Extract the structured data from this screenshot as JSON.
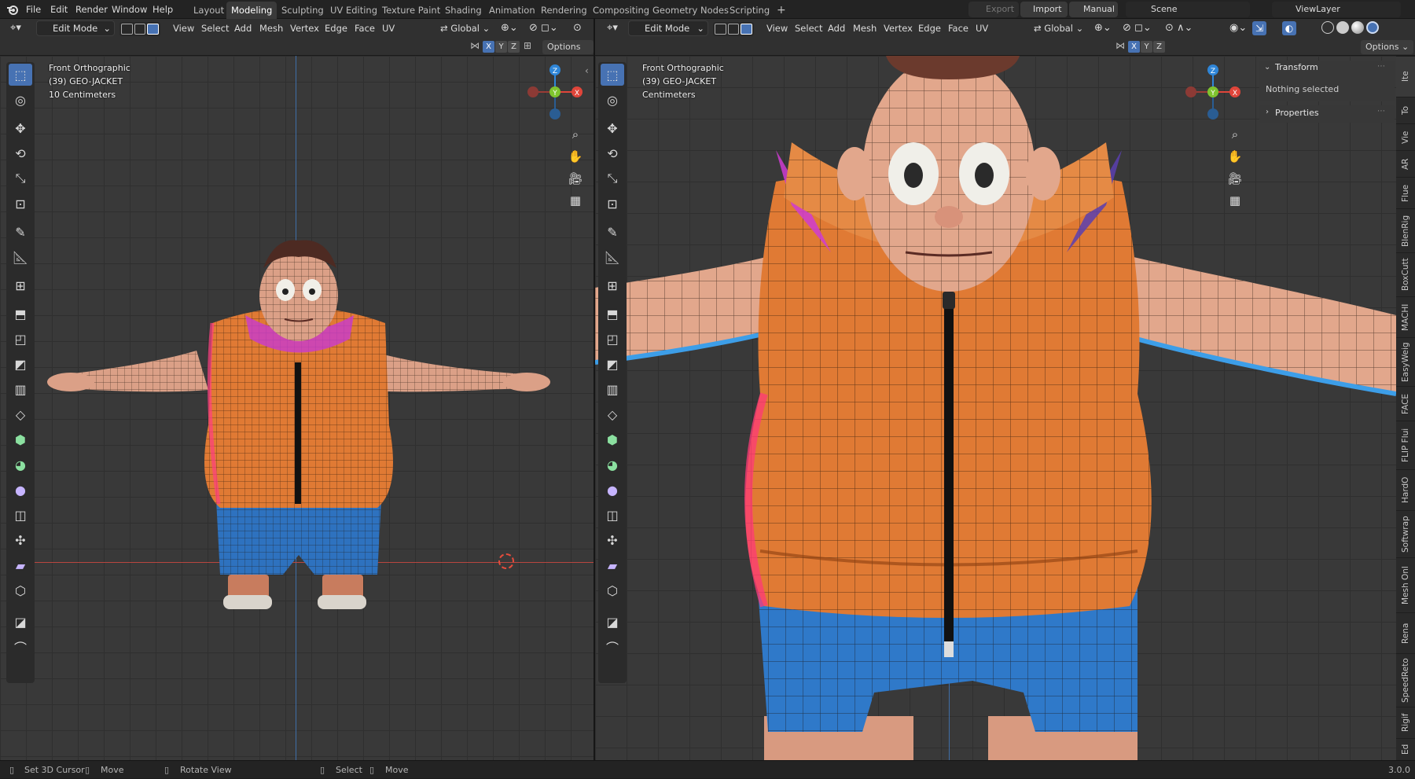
{
  "app": {
    "version": "3.0.0"
  },
  "menu": [
    "File",
    "Edit",
    "Render",
    "Window",
    "Help"
  ],
  "workspaces": [
    "Layout",
    "Modeling",
    "Sculpting",
    "UV Editing",
    "Texture Paint",
    "Shading",
    "Animation",
    "Rendering",
    "Compositing",
    "Geometry Nodes",
    "Scripting"
  ],
  "active_workspace": "Modeling",
  "top_right": {
    "export_label": "Export",
    "import_label": "Import",
    "manual_label": "Manual",
    "scene_label": "Scene",
    "viewlayer_label": "ViewLayer"
  },
  "left_view": {
    "mode": "Edit Mode",
    "menus": [
      "View",
      "Select",
      "Add",
      "Mesh",
      "Vertex",
      "Edge",
      "Face",
      "UV"
    ],
    "orientation": "Global",
    "axes": [
      "X",
      "Y",
      "Z"
    ],
    "options_label": "Options",
    "overlay": {
      "view_name": "Front Orthographic",
      "object": "(39) GEO-JACKET",
      "scale": "10 Centimeters"
    }
  },
  "right_view": {
    "mode": "Edit Mode",
    "menus": [
      "View",
      "Select",
      "Add",
      "Mesh",
      "Vertex",
      "Edge",
      "Face",
      "UV"
    ],
    "orientation": "Global",
    "axes": [
      "X",
      "Y",
      "Z"
    ],
    "options_label": "Options",
    "overlay": {
      "view_name": "Front Orthographic",
      "object": "(39) GEO-JACKET",
      "scale": "Centimeters"
    }
  },
  "gizmo": {
    "z": "Z",
    "y": "Y",
    "x": "X"
  },
  "sidebar_panel": {
    "transform_title": "Transform",
    "nothing_selected": "Nothing selected",
    "properties_title": "Properties"
  },
  "side_tabs": [
    "Ite",
    "To",
    "Vie",
    "AR",
    "Flue",
    "BlenRig",
    "BoxCutt",
    "MACHI",
    "EasyWeig",
    "FACE",
    "FLIP Flui",
    "HardO",
    "Softwrap",
    "Mesh Onl",
    "Rena",
    "SpeedReto",
    "Rigif",
    "Ed"
  ],
  "status": [
    {
      "icon": "mouse-left-icon",
      "label": "Set 3D Cursor"
    },
    {
      "icon": "mouse-middle-icon",
      "label": "Move"
    },
    {
      "icon": "mouse-right-icon",
      "label": "Rotate View"
    },
    {
      "icon": "mouse-left-icon",
      "label": "Select"
    },
    {
      "icon": "mouse-middle-icon",
      "label": "Move"
    }
  ],
  "colors": {
    "accent": "#4772b3",
    "jacket": "#e07a34",
    "shorts": "#2f79c9",
    "skin": "#e2a78c",
    "axis_red": "#e0453a",
    "axis_green": "#7fc42e",
    "axis_blue": "#2f86d8"
  }
}
